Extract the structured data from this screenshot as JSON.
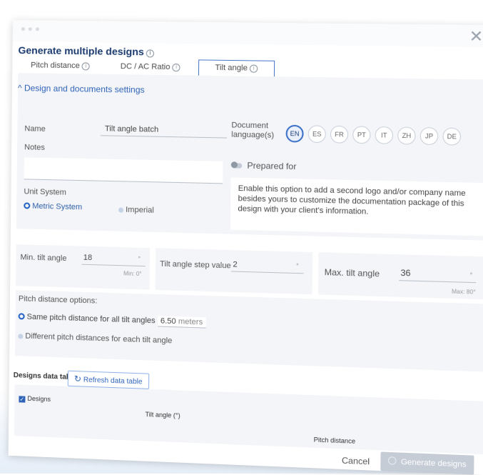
{
  "dialog": {
    "title": "Generate multiple designs",
    "info_glyph": "i"
  },
  "tabs": [
    {
      "label": "Pitch distance"
    },
    {
      "label": "DC / AC Ratio"
    },
    {
      "label": "Tilt angle",
      "active": true
    }
  ],
  "settings": {
    "collapse_label": "^ Design and documents settings",
    "name_label": "Name",
    "name_value": "Tilt angle batch",
    "notes_label": "Notes",
    "unit_system_label": "Unit System",
    "unit_options": [
      "Metric System",
      "Imperial"
    ],
    "unit_selected": "Metric System",
    "doc_lang_label": "Document language(s)",
    "languages": [
      "EN",
      "ES",
      "FR",
      "PT",
      "IT",
      "ZH",
      "JP",
      "DE"
    ],
    "language_selected": "EN",
    "prepared_for_label": "Prepared for",
    "prepared_for_hint": "Enable this option to add a second logo and/or company name besides yours to customize the documentation package of this design with your client's information."
  },
  "tilt": {
    "min_label": "Min. tilt angle",
    "min_value": "18",
    "min_hint": "Min: 0°",
    "step_label": "Tilt angle step value",
    "step_value": "2",
    "max_label": "Max. tilt angle",
    "max_value": "36",
    "max_hint": "Max: 80°",
    "unit": "°"
  },
  "pitch": {
    "title": "Pitch distance options:",
    "option_same": "Same pitch distance for all tilt angles",
    "same_value": "6.50",
    "same_unit": "meters",
    "option_diff": "Different pitch distances for each tilt angle"
  },
  "table": {
    "title": "Designs data table",
    "refresh_label": "Refresh data table",
    "columns": [
      "Designs",
      "Tilt angle (°)",
      "Pitch distance"
    ]
  },
  "footer": {
    "cancel_label": "Cancel",
    "generate_label": "Generate designs"
  },
  "colors": {
    "accent": "#2f63b8",
    "title": "#1b3b6f",
    "panel": "#f3f5f8",
    "disabled_button": "#c5ccd6"
  }
}
